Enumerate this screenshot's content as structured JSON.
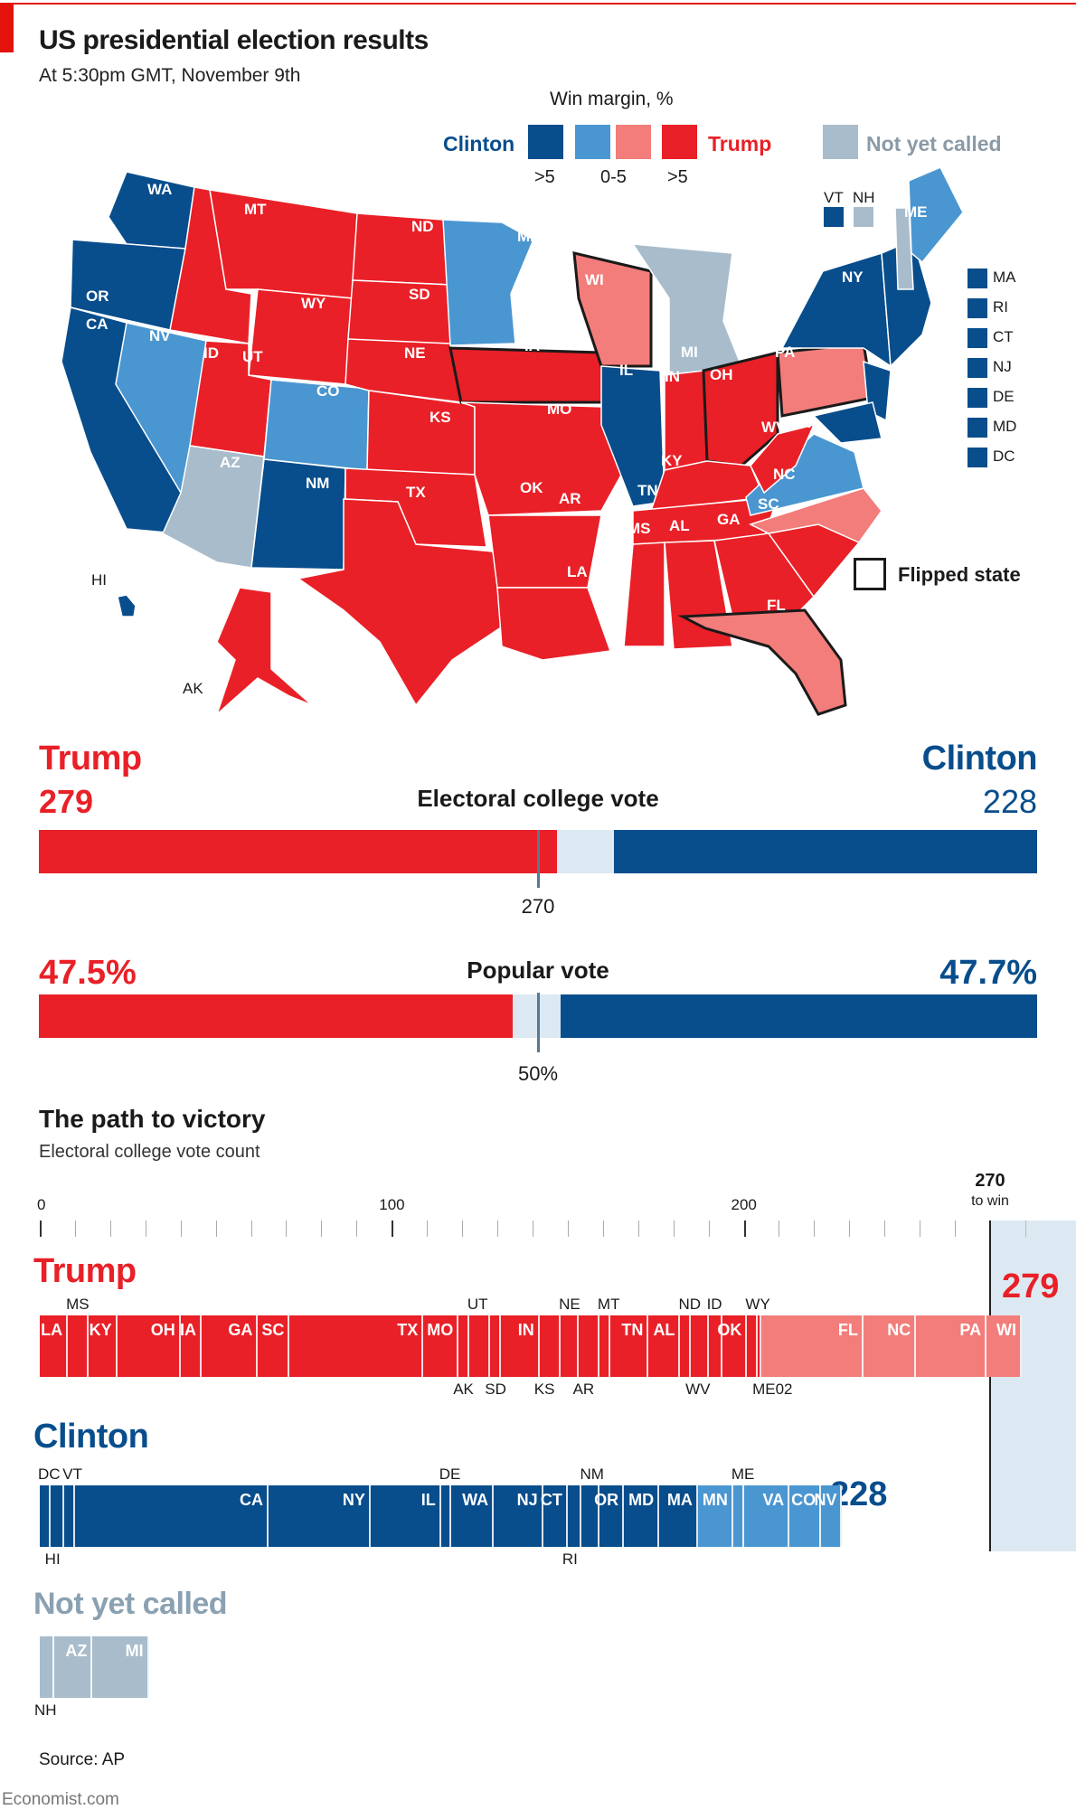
{
  "header": {
    "title": "US presidential election results",
    "subtitle": "At 5:30pm GMT, November 9th"
  },
  "colors": {
    "clinton_strong": "#084d8c",
    "clinton_lean": "#4a96d1",
    "trump_lean": "#f27d7a",
    "trump_strong": "#e92027",
    "not_called": "#a8bccb",
    "win_zone": "#dce9f2",
    "not_called_text": "#8aa1b1"
  },
  "legend": {
    "heading": "Win margin, %",
    "clinton_label": "Clinton",
    "trump_label": "Trump",
    "not_called_label": "Not yet called",
    "bins": [
      ">5",
      "0-5",
      ">5"
    ],
    "vt_label": "VT",
    "nh_label": "NH",
    "small_states": [
      "MA",
      "RI",
      "CT",
      "NJ",
      "DE",
      "MD",
      "DC"
    ],
    "flipped_label": "Flipped state"
  },
  "map": {
    "labels": [
      "WA",
      "OR",
      "CA",
      "NV",
      "ID",
      "MT",
      "WY",
      "UT",
      "CO",
      "AZ",
      "NM",
      "ND",
      "SD",
      "NE",
      "KS",
      "OK",
      "TX",
      "MN",
      "IA",
      "MO",
      "AR",
      "LA",
      "WI",
      "IL",
      "MI",
      "IN",
      "OH",
      "KY",
      "TN",
      "MS",
      "AL",
      "GA",
      "FL",
      "SC",
      "NC",
      "VA",
      "WV",
      "PA",
      "NY",
      "ME",
      "HI",
      "AK"
    ],
    "flipped": [
      "WI",
      "IA",
      "OH",
      "PA",
      "FL"
    ]
  },
  "electoral": {
    "trump_name": "Trump",
    "clinton_name": "Clinton",
    "trump_votes": "279",
    "clinton_votes": "228",
    "label": "Electoral college vote",
    "threshold_label": "270"
  },
  "popular": {
    "trump_pct": "47.5%",
    "clinton_pct": "47.7%",
    "label": "Popular vote",
    "threshold_label": "50%"
  },
  "path": {
    "title": "The path to victory",
    "subtitle": "Electoral college vote count",
    "win_label_num": "270",
    "win_label_text": "to win",
    "trump_heading": "Trump",
    "clinton_heading": "Clinton",
    "not_called_heading": "Not yet called",
    "trump_total": "279",
    "clinton_total": "228"
  },
  "chart_data": [
    {
      "type": "bar",
      "title": "Electoral college vote",
      "series": [
        {
          "name": "Trump",
          "value": 279
        },
        {
          "name": "Not yet called",
          "value": 31
        },
        {
          "name": "Clinton",
          "value": 228
        }
      ],
      "threshold": 270,
      "total": 538
    },
    {
      "type": "bar",
      "title": "Popular vote",
      "series": [
        {
          "name": "Trump",
          "value": 47.5
        },
        {
          "name": "Other",
          "value": 4.8
        },
        {
          "name": "Clinton",
          "value": 47.7
        }
      ],
      "threshold": 50,
      "unit": "%"
    },
    {
      "type": "bar",
      "title": "The path to victory",
      "xlabel": "Electoral college vote count",
      "xlim": [
        0,
        270
      ],
      "xticks": [
        0,
        100,
        200
      ],
      "minor_tick_step": 10,
      "series": [
        {
          "name": "Trump",
          "total": 279,
          "states": [
            {
              "state": "LA",
              "votes": 8,
              "margin": "strong",
              "label_pos": "in"
            },
            {
              "state": "MS",
              "votes": 6,
              "margin": "strong",
              "label_pos": "above"
            },
            {
              "state": "KY",
              "votes": 8,
              "margin": "strong",
              "label_pos": "in"
            },
            {
              "state": "OH",
              "votes": 18,
              "margin": "strong",
              "label_pos": "in"
            },
            {
              "state": "IA",
              "votes": 6,
              "margin": "strong",
              "label_pos": "in"
            },
            {
              "state": "GA",
              "votes": 16,
              "margin": "strong",
              "label_pos": "in"
            },
            {
              "state": "SC",
              "votes": 9,
              "margin": "strong",
              "label_pos": "in"
            },
            {
              "state": "TX",
              "votes": 38,
              "margin": "strong",
              "label_pos": "in"
            },
            {
              "state": "MO",
              "votes": 10,
              "margin": "strong",
              "label_pos": "in"
            },
            {
              "state": "AK",
              "votes": 3,
              "margin": "strong",
              "label_pos": "below"
            },
            {
              "state": "UT",
              "votes": 6,
              "margin": "strong",
              "label_pos": "above"
            },
            {
              "state": "SD",
              "votes": 3,
              "margin": "strong",
              "label_pos": "below"
            },
            {
              "state": "IN",
              "votes": 11,
              "margin": "strong",
              "label_pos": "in"
            },
            {
              "state": "KS",
              "votes": 6,
              "margin": "strong",
              "label_pos": "below"
            },
            {
              "state": "NE",
              "votes": 5,
              "margin": "strong",
              "label_pos": "above"
            },
            {
              "state": "AR",
              "votes": 6,
              "margin": "strong",
              "label_pos": "below"
            },
            {
              "state": "MT",
              "votes": 3,
              "margin": "strong",
              "label_pos": "above"
            },
            {
              "state": "TN",
              "votes": 11,
              "margin": "strong",
              "label_pos": "in"
            },
            {
              "state": "AL",
              "votes": 9,
              "margin": "strong",
              "label_pos": "in"
            },
            {
              "state": "ND",
              "votes": 3,
              "margin": "strong",
              "label_pos": "above"
            },
            {
              "state": "WV",
              "votes": 5,
              "margin": "strong",
              "label_pos": "below"
            },
            {
              "state": "ID",
              "votes": 4,
              "margin": "strong",
              "label_pos": "above"
            },
            {
              "state": "OK",
              "votes": 7,
              "margin": "strong",
              "label_pos": "in"
            },
            {
              "state": "WY",
              "votes": 3,
              "margin": "strong",
              "label_pos": "above"
            },
            {
              "state": "ME02",
              "votes": 1,
              "margin": "strong",
              "label_pos": "below"
            },
            {
              "state": "FL",
              "votes": 29,
              "margin": "lean",
              "label_pos": "in"
            },
            {
              "state": "NC",
              "votes": 15,
              "margin": "lean",
              "label_pos": "in"
            },
            {
              "state": "PA",
              "votes": 20,
              "margin": "lean",
              "label_pos": "in"
            },
            {
              "state": "WI",
              "votes": 10,
              "margin": "lean",
              "label_pos": "in"
            }
          ]
        },
        {
          "name": "Clinton",
          "total": 228,
          "states": [
            {
              "state": "DC",
              "votes": 3,
              "margin": "strong",
              "label_pos": "above"
            },
            {
              "state": "HI",
              "votes": 4,
              "margin": "strong",
              "label_pos": "below"
            },
            {
              "state": "VT",
              "votes": 3,
              "margin": "strong",
              "label_pos": "above"
            },
            {
              "state": "CA",
              "votes": 55,
              "margin": "strong",
              "label_pos": "in"
            },
            {
              "state": "NY",
              "votes": 29,
              "margin": "strong",
              "label_pos": "in"
            },
            {
              "state": "IL",
              "votes": 20,
              "margin": "strong",
              "label_pos": "in"
            },
            {
              "state": "DE",
              "votes": 3,
              "margin": "strong",
              "label_pos": "above"
            },
            {
              "state": "WA",
              "votes": 12,
              "margin": "strong",
              "label_pos": "in"
            },
            {
              "state": "NJ",
              "votes": 14,
              "margin": "strong",
              "label_pos": "in"
            },
            {
              "state": "CT",
              "votes": 7,
              "margin": "strong",
              "label_pos": "in"
            },
            {
              "state": "RI",
              "votes": 4,
              "margin": "strong",
              "label_pos": "below"
            },
            {
              "state": "NM",
              "votes": 5,
              "margin": "strong",
              "label_pos": "above"
            },
            {
              "state": "OR",
              "votes": 7,
              "margin": "strong",
              "label_pos": "in"
            },
            {
              "state": "MD",
              "votes": 10,
              "margin": "strong",
              "label_pos": "in"
            },
            {
              "state": "MA",
              "votes": 11,
              "margin": "strong",
              "label_pos": "in"
            },
            {
              "state": "MN",
              "votes": 10,
              "margin": "lean",
              "label_pos": "in"
            },
            {
              "state": "ME",
              "votes": 3,
              "margin": "lean",
              "label_pos": "above"
            },
            {
              "state": "VA",
              "votes": 13,
              "margin": "lean",
              "label_pos": "in"
            },
            {
              "state": "CO",
              "votes": 9,
              "margin": "lean",
              "label_pos": "in"
            },
            {
              "state": "NV",
              "votes": 6,
              "margin": "lean",
              "label_pos": "in"
            }
          ]
        },
        {
          "name": "Not yet called",
          "total": 31,
          "states": [
            {
              "state": "NH",
              "votes": 4,
              "margin": "none",
              "label_pos": "below"
            },
            {
              "state": "AZ",
              "votes": 11,
              "margin": "none",
              "label_pos": "in"
            },
            {
              "state": "MI",
              "votes": 16,
              "margin": "none",
              "label_pos": "in"
            }
          ]
        }
      ]
    }
  ],
  "footer": {
    "source": "Source: AP",
    "brand": "Economist.com"
  }
}
